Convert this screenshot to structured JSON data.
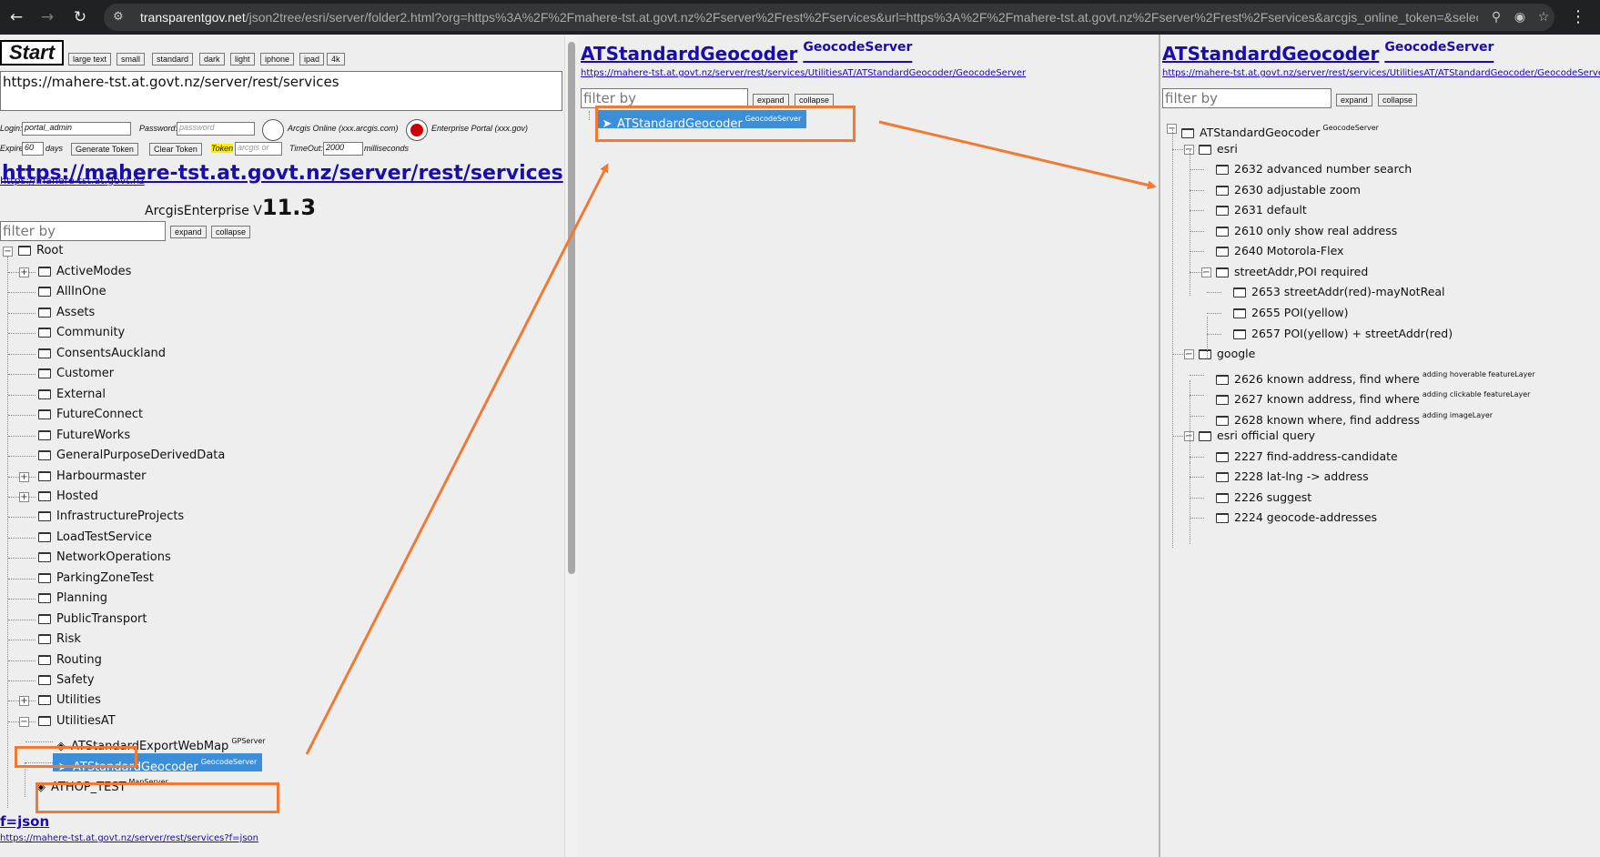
{
  "browser": {
    "url_host": "transparentgov.net",
    "url_rest": "/json2tree/esri/server/folder2.html?org=https%3A%2F%2Fmahere-tst.at.govt.nz%2Fserver%2Frest%2Fservices&url=https%3A%2F%2Fmahere-tst.at.govt.nz%2Fserver%2Frest%2Fservices&arcgis_online_token=&select..."
  },
  "left": {
    "start_label": "Start",
    "size_buttons": [
      "large text",
      "small",
      "standard",
      "dark",
      "light",
      "iphone",
      "ipad",
      "4k"
    ],
    "url_value": "https://mahere-tst.at.govt.nz/server/rest/services",
    "login_label": "Login:",
    "login_value": "portal_admin",
    "password_label": "Password:",
    "password_placeholder": "password",
    "arcgis_online_label": "Arcgis Online (xxx.arcgis.com)",
    "enterprise_label": "Enterprise Portal (xxx.gov)",
    "expire_label": "Expire",
    "expire_value": "60",
    "days_label": "days",
    "generate_token": "Generate Token",
    "clear_token": "Clear Token",
    "token_label": "Token",
    "token_placeholder": "arcgis or",
    "timeout_label": "TimeOut:",
    "timeout_value": "2000",
    "ms_label": "milliseconds",
    "big_url": "https://mahere-tst.at.govt.nz/server/rest/services",
    "small_url": "https://mahere-tst.at.govt.nz",
    "version_prefix": "ArcgisEnterprise",
    "version_v": "V",
    "version_num": "11.3",
    "filter_placeholder": "filter by",
    "expand": "expand",
    "collapse": "collapse",
    "root": "Root",
    "folders": [
      "ActiveModes",
      "AllInOne",
      "Assets",
      "Community",
      "ConsentsAuckland",
      "Customer",
      "External",
      "FutureConnect",
      "FutureWorks",
      "GeneralPurposeDerivedData",
      "Harbourmaster",
      "Hosted",
      "InfrastructureProjects",
      "LoadTestService",
      "NetworkOperations",
      "ParkingZoneTest",
      "Planning",
      "PublicTransport",
      "Risk",
      "Routing",
      "Safety",
      "Utilities",
      "UtilitiesAT"
    ],
    "utilities_children": [
      {
        "name": "ATStandardExportWebMap",
        "type": "GPServer"
      },
      {
        "name": "ATStandardGeocoder",
        "type": "GeocodeServer"
      }
    ],
    "athop": {
      "name": "ATHOP_TEST",
      "type": "MapServer"
    },
    "fjson_label": "f=json",
    "fjson_url": "https://mahere-tst.at.govt.nz/server/rest/services?f=json"
  },
  "middle": {
    "title": "ATStandardGeocoder",
    "title_type": "GeocodeServer",
    "url": "https://mahere-tst.at.govt.nz/server/rest/services/UtilitiesAT/ATStandardGeocoder/GeocodeServer",
    "filter_placeholder": "filter by",
    "expand": "expand",
    "collapse": "collapse",
    "node_name": "ATStandardGeocoder",
    "node_type": "GeocodeServer"
  },
  "right": {
    "title": "ATStandardGeocoder",
    "title_type": "GeocodeServer",
    "url": "https://mahere-tst.at.govt.nz/server/rest/services/UtilitiesAT/ATStandardGeocoder/GeocodeServer",
    "filter_placeholder": "filter by",
    "expand": "expand",
    "collapse": "collapse",
    "root_name": "ATStandardGeocoder",
    "root_type": "GeocodeServer",
    "esri": "esri",
    "esri_items": [
      "2632 advanced number search",
      "2630 adjustable zoom",
      "2631 default",
      "2610 only show real address",
      "2640 Motorola-Flex"
    ],
    "streetaddr": "streetAddr,POI required",
    "streetaddr_items": [
      "2653 streetAddr(red)-mayNotReal",
      "2655 POI(yellow)",
      "2657 POI(yellow) + streetAddr(red)"
    ],
    "google": "google",
    "google_items": [
      {
        "name": "2626 known address, find where",
        "note": "adding hoverable featureLayer"
      },
      {
        "name": "2627 known address, find where",
        "note": "adding clickable featureLayer"
      },
      {
        "name": "2628 known where, find address",
        "note": "adding imageLayer"
      }
    ],
    "official": "esri official query",
    "official_items": [
      "2227 find-address-candidate",
      "2228 lat-lng -> address",
      "2226 suggest",
      "2224 geocode-addresses"
    ]
  },
  "colors": {
    "highlight": "#f07a33",
    "selected": "#3b8fd9",
    "link": "#1a0dab"
  }
}
